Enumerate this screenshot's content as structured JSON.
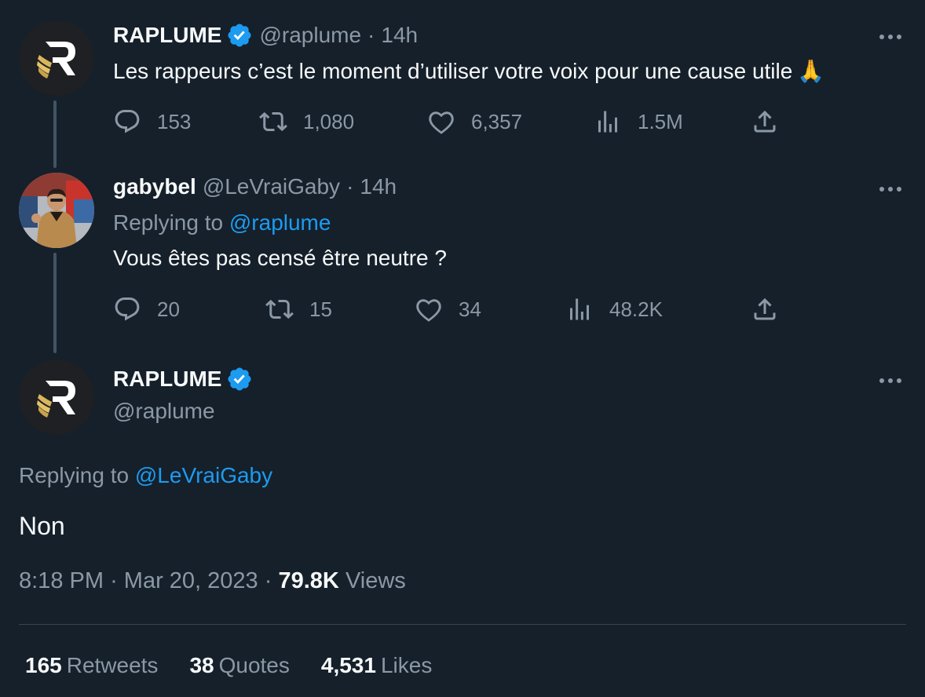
{
  "colors": {
    "background": "#15202b",
    "accent": "#1d9bf0",
    "muted": "#8b98a5",
    "text": "#f7f9f9"
  },
  "tweet1": {
    "name": "RAPLUME",
    "handle": "@raplume",
    "separator": "·",
    "time": "14h",
    "text": "Les rappeurs c’est le moment d’utiliser votre voix pour une cause utile",
    "emoji": "🙏",
    "replies": "153",
    "retweets": "1,080",
    "likes": "6,357",
    "views": "1.5M"
  },
  "tweet2": {
    "name": "gabybel",
    "handle": "@LeVraiGaby",
    "separator": "·",
    "time": "14h",
    "replying_prefix": "Replying to",
    "replying_to": "@raplume",
    "text": "Vous êtes pas censé être neutre ?",
    "replies": "20",
    "retweets": "15",
    "likes": "34",
    "views": "48.2K"
  },
  "main": {
    "name": "RAPLUME",
    "handle": "@raplume",
    "replying_prefix": "Replying to",
    "replying_to": "@LeVraiGaby",
    "text": "Non",
    "time": "8:18 PM",
    "separator": "·",
    "date": "Mar 20, 2023",
    "views_count": "79.8K",
    "views_label": "Views",
    "retweets_count": "165",
    "retweets_label": "Retweets",
    "quotes_count": "38",
    "quotes_label": "Quotes",
    "likes_count": "4,531",
    "likes_label": "Likes"
  }
}
